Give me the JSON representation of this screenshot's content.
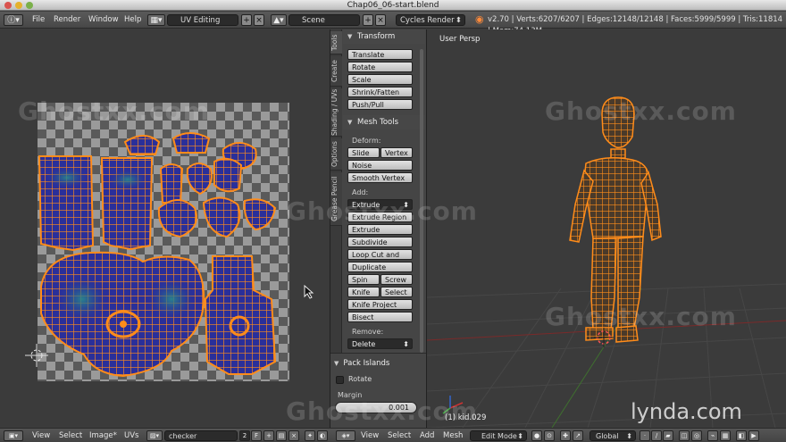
{
  "window": {
    "title": "Chap06_06-start.blend"
  },
  "info_header": {
    "menus": [
      "File",
      "Render",
      "Window",
      "Help"
    ],
    "layout": "UV Editing",
    "scene": "Scene",
    "engine": "Cycles Render",
    "stats": "v2.70 | Verts:6207/6207 | Edges:12148/12148 | Faces:5999/5999 | Tris:11814 | Mem:74.13M"
  },
  "toolshelf": {
    "tabs": [
      "Tools",
      "Create",
      "Shading / UVs",
      "Options",
      "Grease Pencil"
    ],
    "transform": {
      "title": "Transform",
      "buttons": [
        "Translate",
        "Rotate",
        "Scale",
        "Shrink/Fatten",
        "Push/Pull"
      ]
    },
    "mesh_tools": {
      "title": "Mesh Tools",
      "deform_label": "Deform:",
      "slide_edge": "Slide Ed",
      "vertex": "Vertex",
      "noise": "Noise",
      "smooth_vertex": "Smooth Vertex",
      "add_label": "Add:",
      "extrude": "Extrude",
      "add_buttons": [
        "Extrude Region",
        "Extrude Individual",
        "Subdivide",
        "Loop Cut and Slide",
        "Duplicate"
      ],
      "spin": "Spin",
      "screw": "Screw",
      "knife": "Knife",
      "select": "Select",
      "knife_project": "Knife Project",
      "bisect": "Bisect",
      "remove_label": "Remove:",
      "delete": "Delete"
    },
    "pack_islands": {
      "title": "Pack Islands",
      "rotate_label": "Rotate",
      "margin_label": "Margin",
      "margin_value": "0.001"
    }
  },
  "viewport": {
    "view_label": "User Persp",
    "object_label": "(1) kid.029"
  },
  "watermark": {
    "text": "Ghostxx.com",
    "brand": "lynda.com"
  },
  "uv_footer": {
    "menus": [
      "View",
      "Select",
      "Image*",
      "UVs"
    ],
    "image_name": "checker",
    "users": "2",
    "fake": "F"
  },
  "view3d_footer": {
    "menus": [
      "View",
      "Select",
      "Add",
      "Mesh"
    ],
    "mode": "Edit Mode",
    "orientation": "Global"
  },
  "colors": {
    "mesh_orange": "#ff8c1a",
    "uv_fill_blue": "#2a2f9a",
    "checker_light": "#9a9a9a",
    "checker_dark": "#5a5a5a",
    "grid_line": "#4a4a4a"
  }
}
